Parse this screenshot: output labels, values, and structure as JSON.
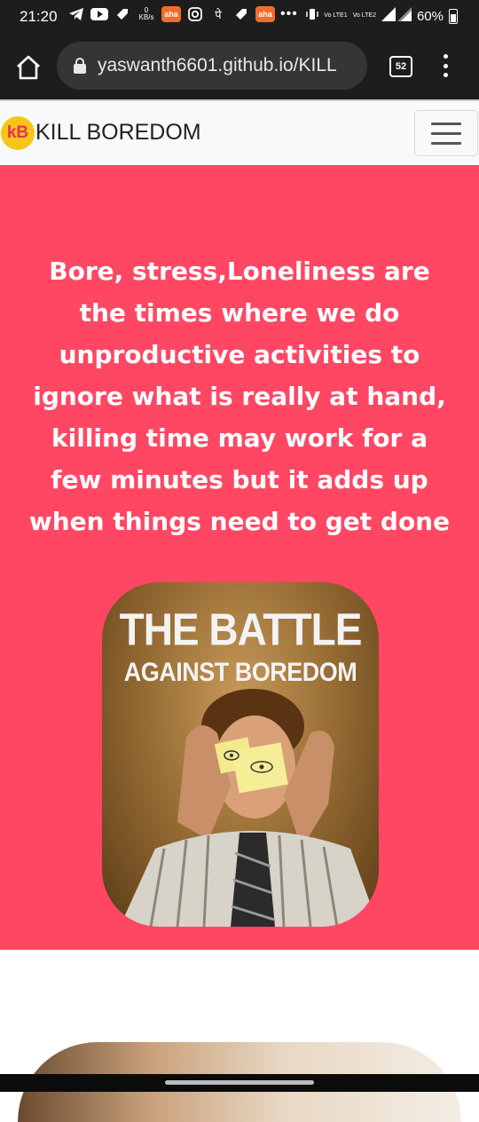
{
  "status_bar": {
    "time": "21:20",
    "net_speed_value": "0",
    "net_speed_unit": "KB/s",
    "aha_label": "aha",
    "aha2_label": "aha",
    "pe_label": "पे",
    "more_label": "•••",
    "network_label_1": "Vo LTE1",
    "network_label_2": "Vo LTE2",
    "battery": "60%",
    "icons": [
      "telegram-icon",
      "youtube-icon",
      "tag-icon",
      "instagram-icon",
      "vibrate-icon",
      "signal-icon",
      "battery-icon"
    ]
  },
  "browser": {
    "url": "yaswanth6601.github.io/KILL",
    "tab_count": "52",
    "icons": [
      "home-icon",
      "lock-icon",
      "tabs-icon",
      "overflow-menu-icon"
    ]
  },
  "navbar": {
    "logo_text": "kB",
    "brand": "KILL BOREDOM",
    "icons": [
      "hamburger-icon"
    ]
  },
  "hero": {
    "text": "Bore, stress,Loneliness are the times where we do unproductive activities to ignore what is really at hand, killing time may work for a few minutes but it adds up when things need to get done",
    "image_title_line1": "THE BATTLE",
    "image_title_line2": "AGAINST BOREDOM"
  },
  "colors": {
    "hero_bg": "#ff4763",
    "status_bar_bg": "#1d1d1d",
    "navbar_bg": "#f8f9fa",
    "logo_bg": "#f5c518",
    "logo_text": "#e8325a"
  }
}
